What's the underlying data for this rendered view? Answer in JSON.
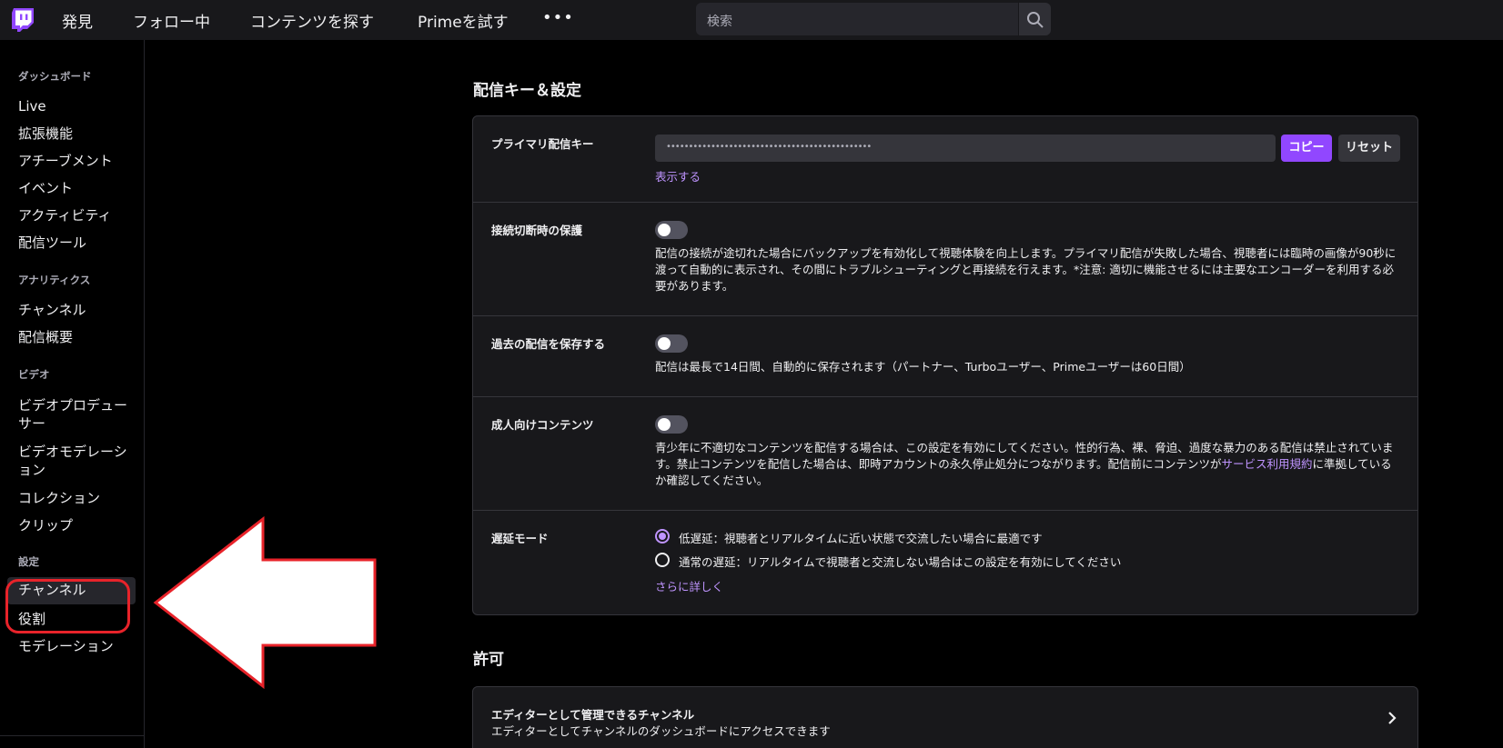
{
  "topnav": {
    "items": [
      "発見",
      "フォロー中",
      "コンテンツを探す",
      "Primeを試す"
    ],
    "more": "•••",
    "search_placeholder": "検索"
  },
  "sidebar": {
    "heading_dashboard": "ダッシュボード",
    "dashboard_items": [
      "Live",
      "拡張機能",
      "アチーブメント",
      "イベント",
      "アクティビティ",
      "配信ツール"
    ],
    "heading_analytics": "アナリティクス",
    "analytics_items": [
      "チャンネル",
      "配信概要"
    ],
    "heading_video": "ビデオ",
    "video_items": [
      "ビデオプロデューサー",
      "ビデオモデレーション",
      "コレクション",
      "クリップ"
    ],
    "heading_settings": "設定",
    "settings_items": [
      "チャンネル",
      "役割",
      "モデレーション"
    ]
  },
  "stream_key_section": {
    "title": "配信キー＆設定",
    "primary_key_label": "プライマリ配信キー",
    "key_masked": "••••••••••••••••••••••••••••••••••••••••••••••",
    "copy_label": "コピー",
    "reset_label": "リセット",
    "show_link": "表示する",
    "disconnect_label": "接続切断時の保護",
    "disconnect_desc": "配信の接続が途切れた場合にバックアップを有効化して視聴体験を向上します。プライマリ配信が失敗した場合、視聴者には臨時の画像が90秒に渡って自動的に表示され、その間にトラブルシューティングと再接続を行えます。*注意: 適切に機能させるには主要なエンコーダーを利用する必要があります。",
    "archive_label": "過去の配信を保存する",
    "archive_desc": "配信は最長で14日間、自動的に保存されます（パートナー、Turboユーザー、Primeユーザーは60日間）",
    "mature_label": "成人向けコンテンツ",
    "mature_desc_1": "青少年に不適切なコンテンツを配信する場合は、この設定を有効にしてください。性的行為、裸、脅迫、過度な暴力のある配信は禁止されています。禁止コンテンツを配信した場合は、即時アカウントの永久停止処分につながります。配信前にコンテンツが",
    "mature_link": "サービス利用規約",
    "mature_desc_2": "に準拠しているか確認してください。",
    "latency_label": "遅延モード",
    "latency_low": "低遅延：視聴者とリアルタイムに近い状態で交流したい場合に最適です",
    "latency_normal": "通常の遅延：リアルタイムで視聴者と交流しない場合はこの設定を有効にしてください",
    "latency_selected": "低遅延",
    "learn_more": "さらに詳しく"
  },
  "permissions_section": {
    "title": "許可",
    "editor_title": "エディターとして管理できるチャンネル",
    "editor_sub": "エディターとしてチャンネルのダッシュボードにアクセスできます"
  },
  "colors": {
    "accent": "#9147ff",
    "link": "#bf94ff",
    "annotation": "#e8232a"
  }
}
